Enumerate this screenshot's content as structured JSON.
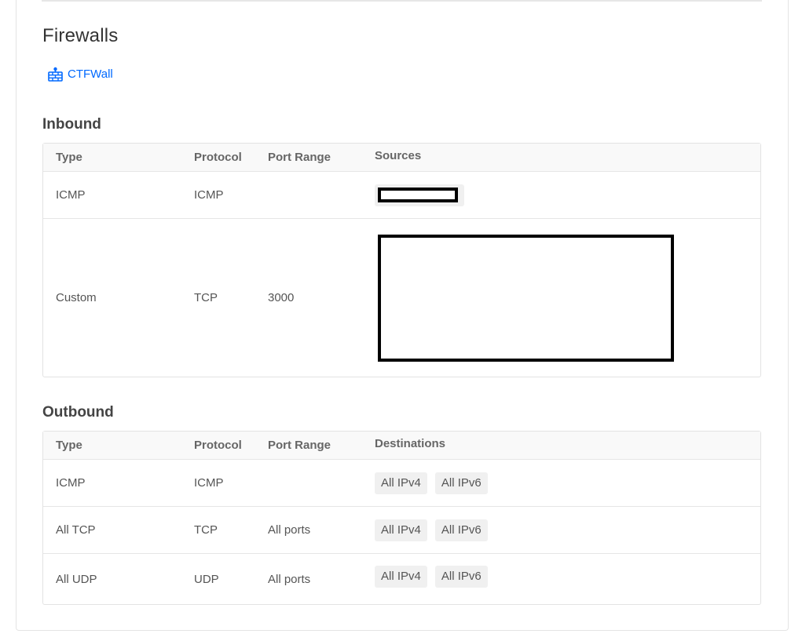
{
  "firewalls": {
    "title": "Firewalls",
    "link_label": "CTFWall",
    "link_color": "#0069ff"
  },
  "inbound": {
    "title": "Inbound",
    "headers": {
      "type": "Type",
      "protocol": "Protocol",
      "port_range": "Port Range",
      "targets": "Sources"
    },
    "rows": [
      {
        "type": "ICMP",
        "protocol": "ICMP",
        "port_range": ""
      },
      {
        "type": "Custom",
        "protocol": "TCP",
        "port_range": "3000"
      }
    ]
  },
  "outbound": {
    "title": "Outbound",
    "headers": {
      "type": "Type",
      "protocol": "Protocol",
      "port_range": "Port Range",
      "targets": "Destinations"
    },
    "rows": [
      {
        "type": "ICMP",
        "protocol": "ICMP",
        "port_range": "",
        "tags": [
          "All IPv4",
          "All IPv6"
        ]
      },
      {
        "type": "All TCP",
        "protocol": "TCP",
        "port_range": "All ports",
        "tags": [
          "All IPv4",
          "All IPv6"
        ]
      },
      {
        "type": "All UDP",
        "protocol": "UDP",
        "port_range": "All ports",
        "tags": [
          "All IPv4",
          "All IPv6"
        ]
      }
    ]
  }
}
